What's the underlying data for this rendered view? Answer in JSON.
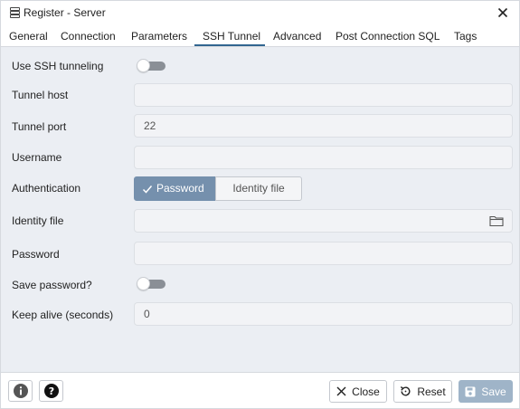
{
  "window": {
    "title": "Register - Server",
    "title_icon": "server-icon",
    "close_icon": "close-icon"
  },
  "tabs": [
    {
      "label": "General",
      "active": false
    },
    {
      "label": "Connection",
      "active": false
    },
    {
      "label": "Parameters",
      "active": false
    },
    {
      "label": "SSH Tunnel",
      "active": true
    },
    {
      "label": "Advanced",
      "active": false
    },
    {
      "label": "Post Connection SQL",
      "active": false
    },
    {
      "label": "Tags",
      "active": false
    }
  ],
  "form": {
    "use_ssh": {
      "label": "Use SSH tunneling",
      "enabled": false
    },
    "tunnel_host": {
      "label": "Tunnel host",
      "value": ""
    },
    "tunnel_port": {
      "label": "Tunnel port",
      "value": "22"
    },
    "username": {
      "label": "Username",
      "value": ""
    },
    "authentication": {
      "label": "Authentication",
      "options": [
        "Password",
        "Identity file"
      ],
      "selected": "Password"
    },
    "identity_file": {
      "label": "Identity file",
      "value": "",
      "icon": "folder-icon"
    },
    "password": {
      "label": "Password",
      "value": ""
    },
    "save_password": {
      "label": "Save password?",
      "enabled": false
    },
    "keep_alive": {
      "label": "Keep alive (seconds)",
      "value": "0"
    }
  },
  "footer": {
    "info_icon": "info-icon",
    "help_icon": "help-icon",
    "close_label": "Close",
    "reset_label": "Reset",
    "save_label": "Save"
  },
  "colors": {
    "accent": "#326690",
    "selected_segment": "#7590ad",
    "body_background": "#ebeef3",
    "save_disabled": "#9fb4c8"
  }
}
